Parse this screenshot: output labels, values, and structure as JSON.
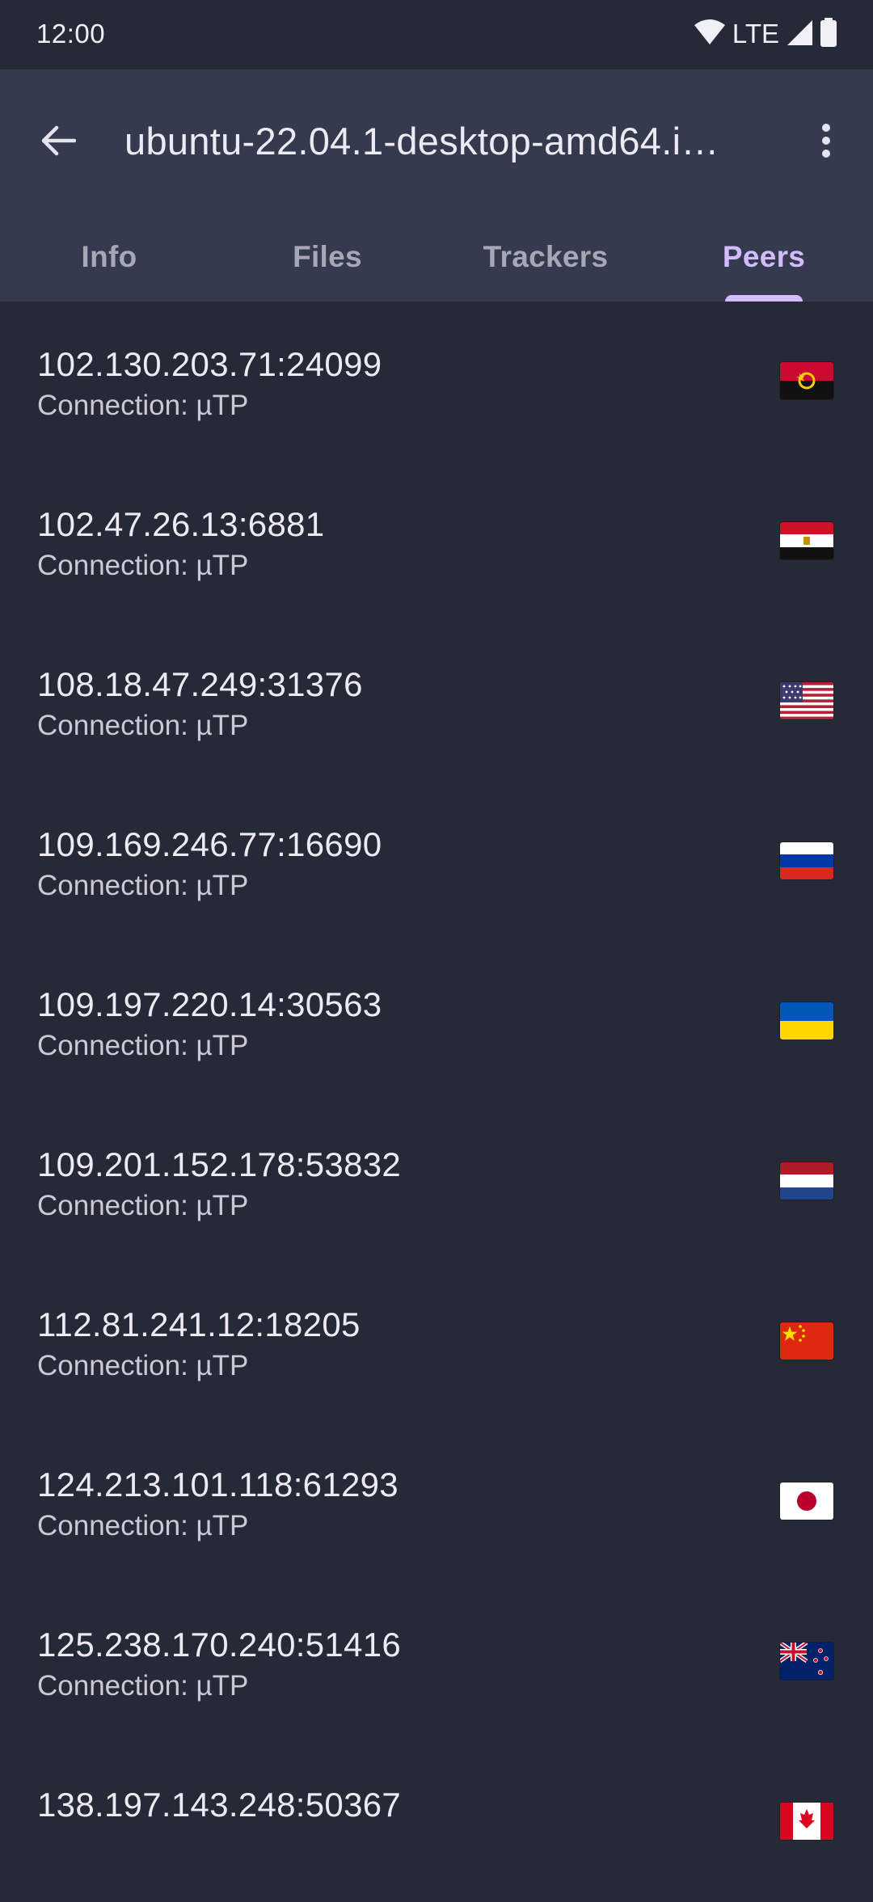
{
  "status_bar": {
    "time": "12:00",
    "network": "LTE",
    "icons": [
      "wifi-icon",
      "signal-icon",
      "battery-icon"
    ]
  },
  "header": {
    "title": "ubuntu-22.04.1-desktop-amd64.i…",
    "back_icon": "arrow-back-icon",
    "more_icon": "more-vert-icon"
  },
  "tabs": [
    {
      "label": "Info",
      "active": false
    },
    {
      "label": "Files",
      "active": false
    },
    {
      "label": "Trackers",
      "active": false
    },
    {
      "label": "Peers",
      "active": true
    }
  ],
  "colors": {
    "background": "#262a37",
    "header": "#363a4e",
    "accent": "#d3bbff",
    "tab_inactive": "#a8a7b5"
  },
  "peers": [
    {
      "address": "102.130.203.71:24099",
      "connection": "Connection: µTP",
      "flag": "angola-flag-icon"
    },
    {
      "address": "102.47.26.13:6881",
      "connection": "Connection: µTP",
      "flag": "egypt-flag-icon"
    },
    {
      "address": "108.18.47.249:31376",
      "connection": "Connection: µTP",
      "flag": "usa-flag-icon"
    },
    {
      "address": "109.169.246.77:16690",
      "connection": "Connection: µTP",
      "flag": "russia-flag-icon"
    },
    {
      "address": "109.197.220.14:30563",
      "connection": "Connection: µTP",
      "flag": "ukraine-flag-icon"
    },
    {
      "address": "109.201.152.178:53832",
      "connection": "Connection: µTP",
      "flag": "netherlands-flag-icon"
    },
    {
      "address": "112.81.241.12:18205",
      "connection": "Connection: µTP",
      "flag": "china-flag-icon"
    },
    {
      "address": "124.213.101.118:61293",
      "connection": "Connection: µTP",
      "flag": "japan-flag-icon"
    },
    {
      "address": "125.238.170.240:51416",
      "connection": "Connection: µTP",
      "flag": "new-zealand-flag-icon"
    },
    {
      "address": "138.197.143.248:50367",
      "connection": "",
      "flag": "canada-flag-icon"
    }
  ]
}
